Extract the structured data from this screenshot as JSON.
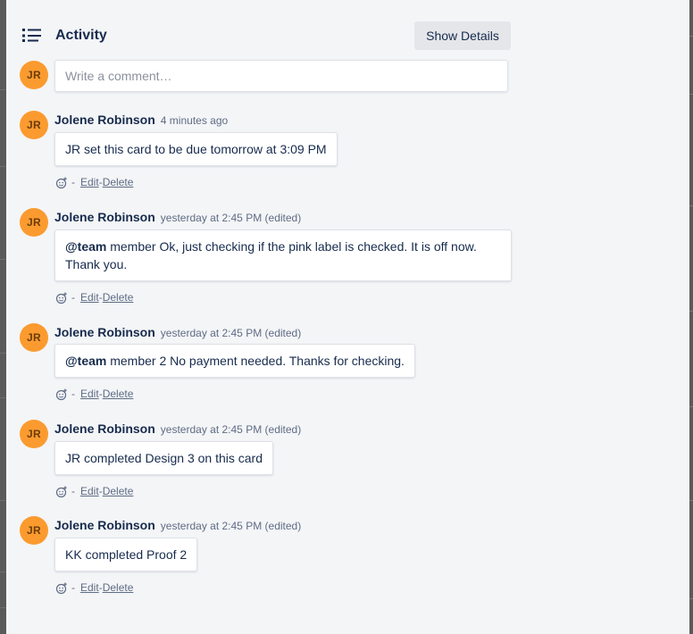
{
  "activity": {
    "title": "Activity",
    "show_details_label": "Show Details",
    "icon": "activity-list-icon"
  },
  "comment_box": {
    "avatar_initials": "JR",
    "placeholder": "Write a comment…"
  },
  "entries": [
    {
      "initials": "JR",
      "author": "Jolene Robinson",
      "time": "4 minutes ago",
      "mention": "",
      "text": "JR set this card to be due tomorrow at 3:09 PM",
      "react_icon": "add-reaction-icon",
      "dash": "-",
      "edit_label": "Edit",
      "sep": "-",
      "delete_label": "Delete"
    },
    {
      "initials": "JR",
      "author": "Jolene Robinson",
      "time": "yesterday at 2:45 PM (edited)",
      "mention": "@team",
      "text": " member Ok, just checking if the pink label is checked. It is off now. Thank you.",
      "react_icon": "add-reaction-icon",
      "dash": "-",
      "edit_label": "Edit",
      "sep": "-",
      "delete_label": "Delete"
    },
    {
      "initials": "JR",
      "author": "Jolene Robinson",
      "time": "yesterday at 2:45 PM (edited)",
      "mention": "@team",
      "text": " member 2 No payment needed. Thanks for checking.",
      "react_icon": "add-reaction-icon",
      "dash": "-",
      "edit_label": "Edit",
      "sep": "-",
      "delete_label": "Delete"
    },
    {
      "initials": "JR",
      "author": "Jolene Robinson",
      "time": "yesterday at 2:45 PM (edited)",
      "mention": "",
      "text": "JR completed Design 3 on this card",
      "react_icon": "add-reaction-icon",
      "dash": "-",
      "edit_label": "Edit",
      "sep": "-",
      "delete_label": "Delete"
    },
    {
      "initials": "JR",
      "author": "Jolene Robinson",
      "time": "yesterday at 2:45 PM (edited)",
      "mention": "",
      "text": "KK completed Proof 2",
      "react_icon": "add-reaction-icon",
      "dash": "-",
      "edit_label": "Edit",
      "sep": "-",
      "delete_label": "Delete"
    }
  ],
  "colors": {
    "avatar_bg": "#fb9b2f",
    "panel_bg": "#f4f5f7",
    "text_primary": "#172b4d",
    "text_secondary": "#5e6c84"
  }
}
